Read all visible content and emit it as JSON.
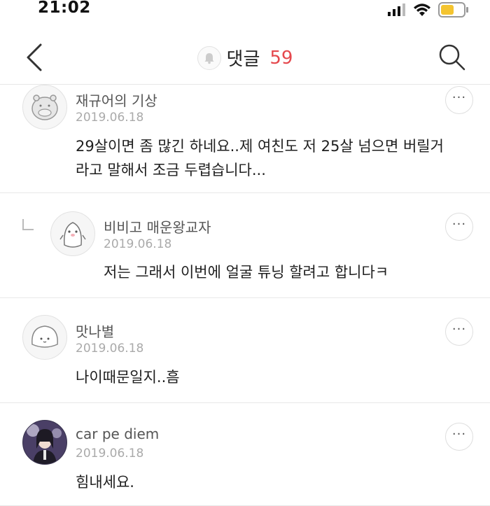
{
  "status_bar": {
    "time": "21:02",
    "icons": [
      "signal-icon",
      "wifi-icon",
      "battery-icon"
    ],
    "battery_color": "#f4c430"
  },
  "header": {
    "title": "댓글",
    "count": "59",
    "count_color": "#e5484d",
    "icons": [
      "back-icon",
      "bell-icon",
      "search-icon"
    ]
  },
  "comments": [
    {
      "author": "재규어의 기상",
      "date": "2019.06.18",
      "lines": [
        "29살이면 좀 많긴 하네요..제 여친도 저 25살 넘으면 버릴거",
        "라고 말해서 조금 두렵습니다..."
      ],
      "is_reply": false
    },
    {
      "author": "비비고 매운왕교자",
      "date": "2019.06.18",
      "lines": [
        "저는 그래서 이번에 얼굴 튜닝 할려고 합니다ㅋ"
      ],
      "is_reply": true
    },
    {
      "author": "맛나별",
      "date": "2019.06.18",
      "lines": [
        "나이때문일지..흠"
      ],
      "is_reply": false
    },
    {
      "author": "car pe diem",
      "date": "2019.06.18",
      "lines": [
        "힘내세요."
      ],
      "is_reply": false
    }
  ],
  "more_label": "···"
}
